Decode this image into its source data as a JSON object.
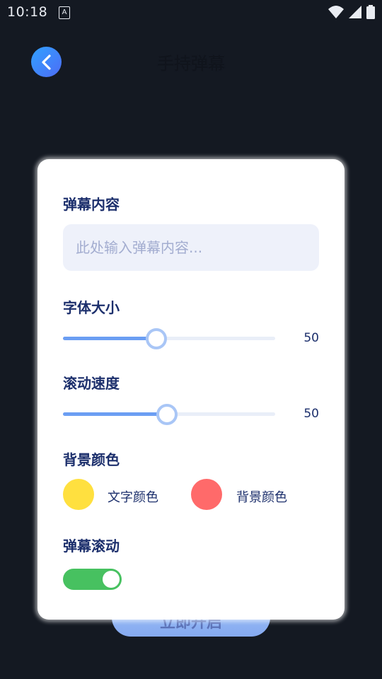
{
  "status_bar": {
    "time": "10:18",
    "notification_glyph": "A",
    "icons": [
      "wifi-icon",
      "signal-icon",
      "battery-icon"
    ]
  },
  "header": {
    "title": "手持弹幕"
  },
  "bottom_button": {
    "label": "立即开启"
  },
  "dialog": {
    "content_section": {
      "label": "弹幕内容",
      "placeholder": "此处输入弹幕内容...",
      "value": ""
    },
    "font_size": {
      "label": "字体大小",
      "value": "50",
      "fraction": 0.44
    },
    "scroll_speed": {
      "label": "滚动速度",
      "value": "50",
      "fraction": 0.49
    },
    "colors": {
      "label": "背景颜色",
      "text_color": {
        "label": "文字颜色",
        "color": "#ffe03f"
      },
      "bg_color": {
        "label": "背景颜色",
        "color": "#ff6a6a"
      }
    },
    "scrolling": {
      "label": "弹幕滚动",
      "enabled": true
    }
  },
  "colors": {
    "background": "#141922",
    "accent_blue": "#6b9ef3",
    "label_navy": "#1c2f6c",
    "toggle_green": "#47c160"
  }
}
